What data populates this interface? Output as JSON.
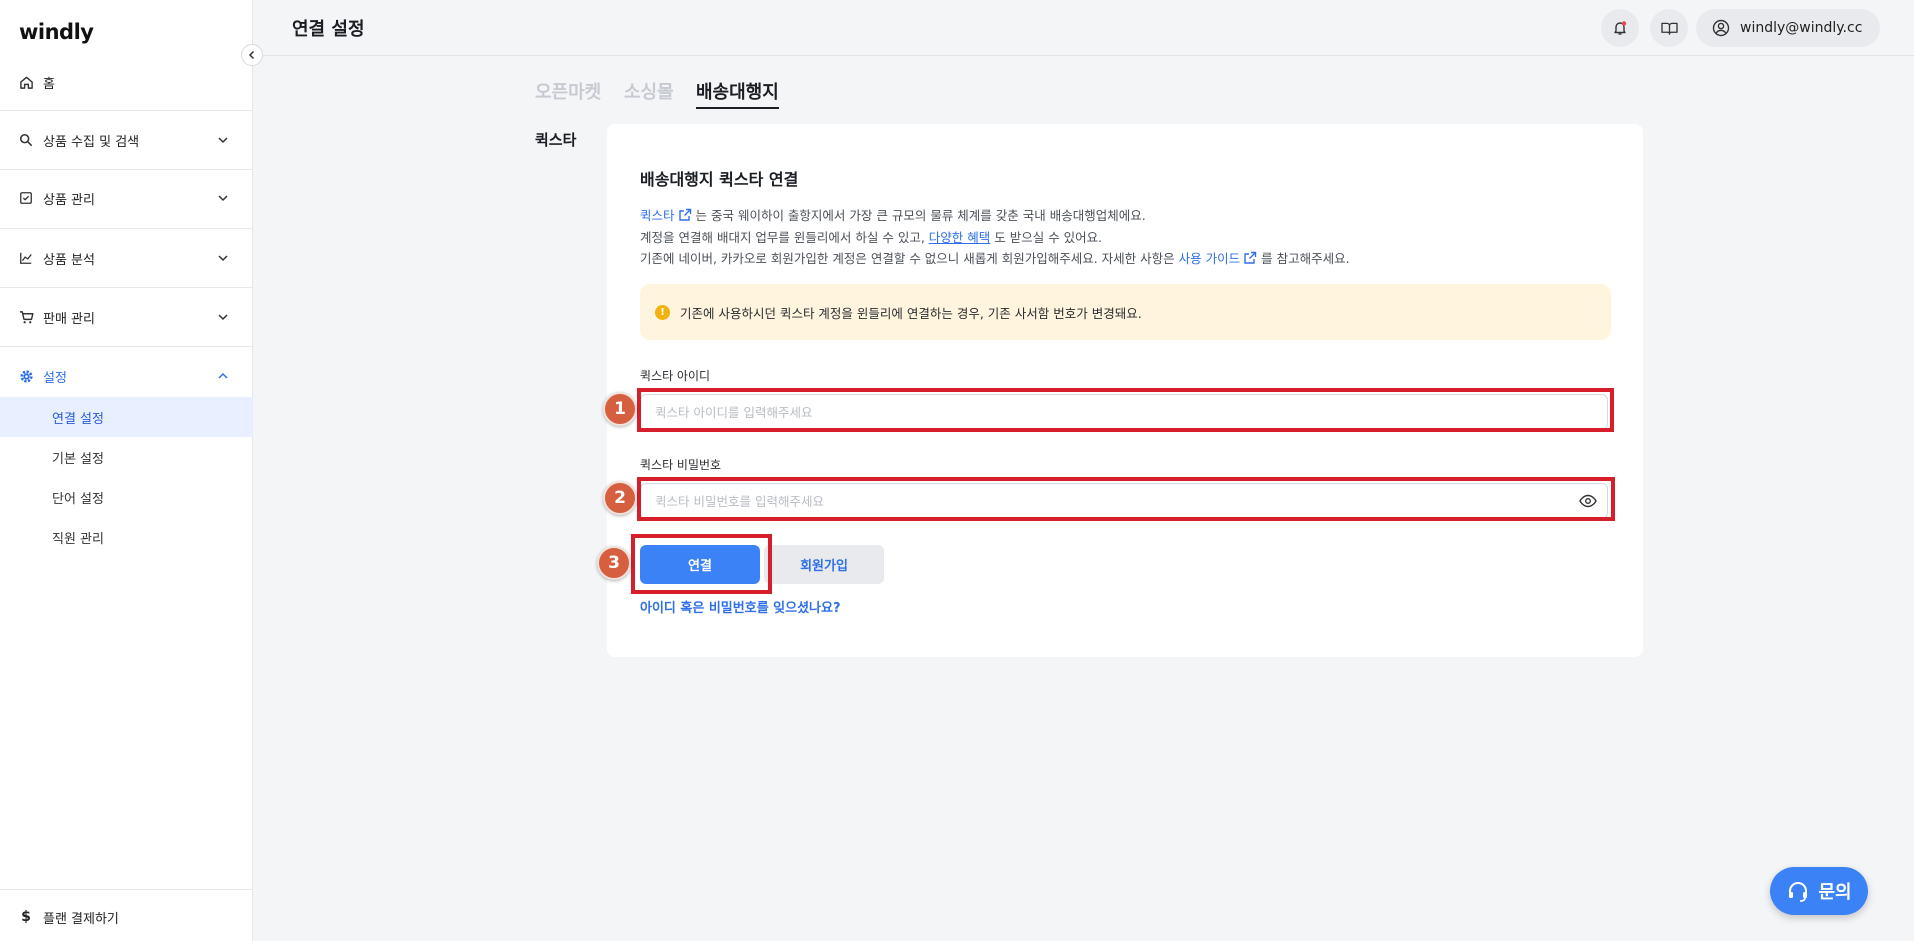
{
  "app": {
    "logo": "windly"
  },
  "sidebar": {
    "home": "홈",
    "items": [
      {
        "label": "상품 수집 및 검색",
        "icon": "search-icon"
      },
      {
        "label": "상품 관리",
        "icon": "checkbox-icon"
      },
      {
        "label": "상품 분석",
        "icon": "chart-icon"
      },
      {
        "label": "판매 관리",
        "icon": "cart-icon"
      },
      {
        "label": "설정",
        "icon": "gear-icon"
      }
    ],
    "sub_items": [
      "연결 설정",
      "기본 설정",
      "단어 설정",
      "직원 관리"
    ],
    "footer": "플랜 결제하기"
  },
  "header": {
    "title": "연결 설정",
    "user": "windly@windly.cc"
  },
  "tabs": [
    "오픈마켓",
    "소싱몰",
    "배송대행지"
  ],
  "section_label": "퀵스타",
  "card": {
    "title": "배송대행지 퀵스타 연결",
    "line1_link": "퀵스타",
    "line1_text": "는 중국 웨이하이 출항지에서 가장 큰 규모의 물류 체계를 갖춘 국내 배송대행업체에요.",
    "line2_pre": "계정을 연결해 배대지 업무를 윈들리에서 하실 수 있고,",
    "line2_link": "다양한 혜택",
    "line2_post": "도 받으실 수 있어요.",
    "line3_pre": "기존에 네이버, 카카오로 회원가입한 계정은 연결할 수 없으니 새롭게 회원가입해주세요. 자세한 사항은",
    "line3_link": "사용 가이드",
    "line3_post": "를 참고해주세요.",
    "notice": "기존에 사용하시던 퀵스타 계정을 윈들리에 연결하는 경우, 기존 사서함 번호가 변경돼요.",
    "id_label": "퀵스타 아이디",
    "id_placeholder": "퀵스타 아이디를 입력해주세요",
    "pw_label": "퀵스타 비밀번호",
    "pw_placeholder": "퀵스타 비밀번호를 입력해주세요",
    "connect_button": "연결",
    "signup_button": "회원가입",
    "forgot_link": "아이디 혹은 비밀번호를 잊으셨나요?"
  },
  "annotations": [
    "1",
    "2",
    "3"
  ],
  "help_button": "문의",
  "colors": {
    "accent": "#3b82f6",
    "highlight": "#d71f2b",
    "badge": "#d65f3f",
    "notice_bg": "#fff4de"
  }
}
